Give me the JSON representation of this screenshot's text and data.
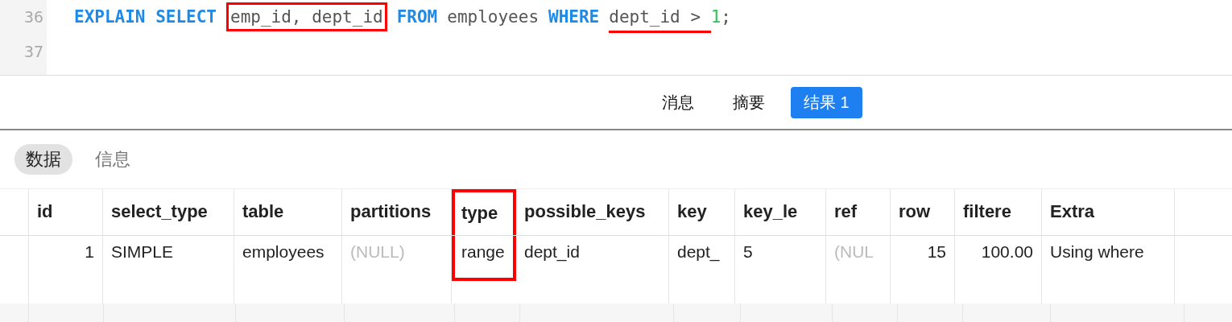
{
  "editor": {
    "lines": [
      {
        "number": "36",
        "tokens": [
          {
            "kind": "keyword",
            "text": "EXPLAIN SELECT"
          },
          {
            "kind": "ident",
            "text": "emp_id, dept_id",
            "boxed": true
          },
          {
            "kind": "keyword",
            "text": "FROM"
          },
          {
            "kind": "ident",
            "text": "employees"
          },
          {
            "kind": "keyword",
            "text": "WHERE"
          },
          {
            "kind": "condition",
            "text": "dept_id > ",
            "underlined": true
          },
          {
            "kind": "number",
            "text": "1"
          },
          {
            "kind": "ident",
            "text": ";"
          }
        ]
      },
      {
        "number": "37"
      }
    ]
  },
  "result_tabs": [
    {
      "label": "消息",
      "selected": false
    },
    {
      "label": "摘要",
      "selected": false
    },
    {
      "label": "结果 1",
      "selected": true
    }
  ],
  "view_tabs": [
    {
      "label": "数据",
      "selected": true
    },
    {
      "label": "信息",
      "selected": false
    }
  ],
  "table": {
    "columns": [
      {
        "label": "id",
        "numeric": true,
        "highlighted": false
      },
      {
        "label": "select_type",
        "numeric": false,
        "highlighted": false
      },
      {
        "label": "table",
        "numeric": false,
        "highlighted": false
      },
      {
        "label": "partitions",
        "numeric": false,
        "highlighted": false
      },
      {
        "label": "type",
        "numeric": false,
        "highlighted": true
      },
      {
        "label": "possible_keys",
        "numeric": false,
        "highlighted": false
      },
      {
        "label": "key",
        "numeric": false,
        "highlighted": false
      },
      {
        "label": "key_le",
        "numeric": false,
        "highlighted": false
      },
      {
        "label": "ref",
        "numeric": false,
        "highlighted": false
      },
      {
        "label": "row",
        "numeric": true,
        "highlighted": false
      },
      {
        "label": "filtere",
        "numeric": true,
        "highlighted": false
      },
      {
        "label": "Extra",
        "numeric": false,
        "highlighted": false
      }
    ],
    "rows": [
      [
        {
          "text": "1",
          "null": false
        },
        {
          "text": "SIMPLE",
          "null": false
        },
        {
          "text": "employees",
          "null": false
        },
        {
          "text": "(NULL)",
          "null": true
        },
        {
          "text": "range",
          "null": false
        },
        {
          "text": "dept_id",
          "null": false
        },
        {
          "text": "dept_",
          "null": false
        },
        {
          "text": "5",
          "null": false
        },
        {
          "text": "(NUL",
          "null": true
        },
        {
          "text": "15",
          "null": false
        },
        {
          "text": "100.00",
          "null": false
        },
        {
          "text": "Using where",
          "null": false
        }
      ]
    ]
  }
}
